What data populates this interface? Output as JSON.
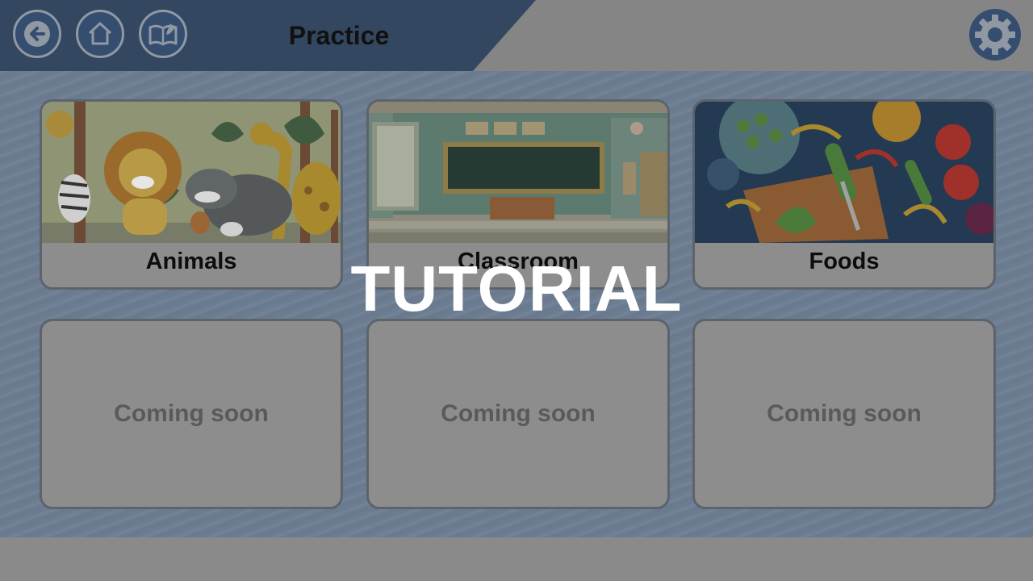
{
  "header": {
    "title": "Practice",
    "back_icon": "back-arrow-icon",
    "home_icon": "home-icon",
    "book_icon": "book-edit-icon",
    "settings_icon": "gear-icon"
  },
  "categories": [
    {
      "label": "Animals",
      "image": "animals-illustration"
    },
    {
      "label": "Classroom",
      "image": "classroom-illustration"
    },
    {
      "label": "Foods",
      "image": "foods-illustration"
    }
  ],
  "placeholders": [
    {
      "label": "Coming soon"
    },
    {
      "label": "Coming soon"
    },
    {
      "label": "Coming soon"
    }
  ],
  "overlay": {
    "text": "TUTORIAL"
  },
  "colors": {
    "header_band": "#344760",
    "button_fill": "#354e70",
    "content_bg": "#6d7d92",
    "card_bg": "#8d8d8d"
  }
}
